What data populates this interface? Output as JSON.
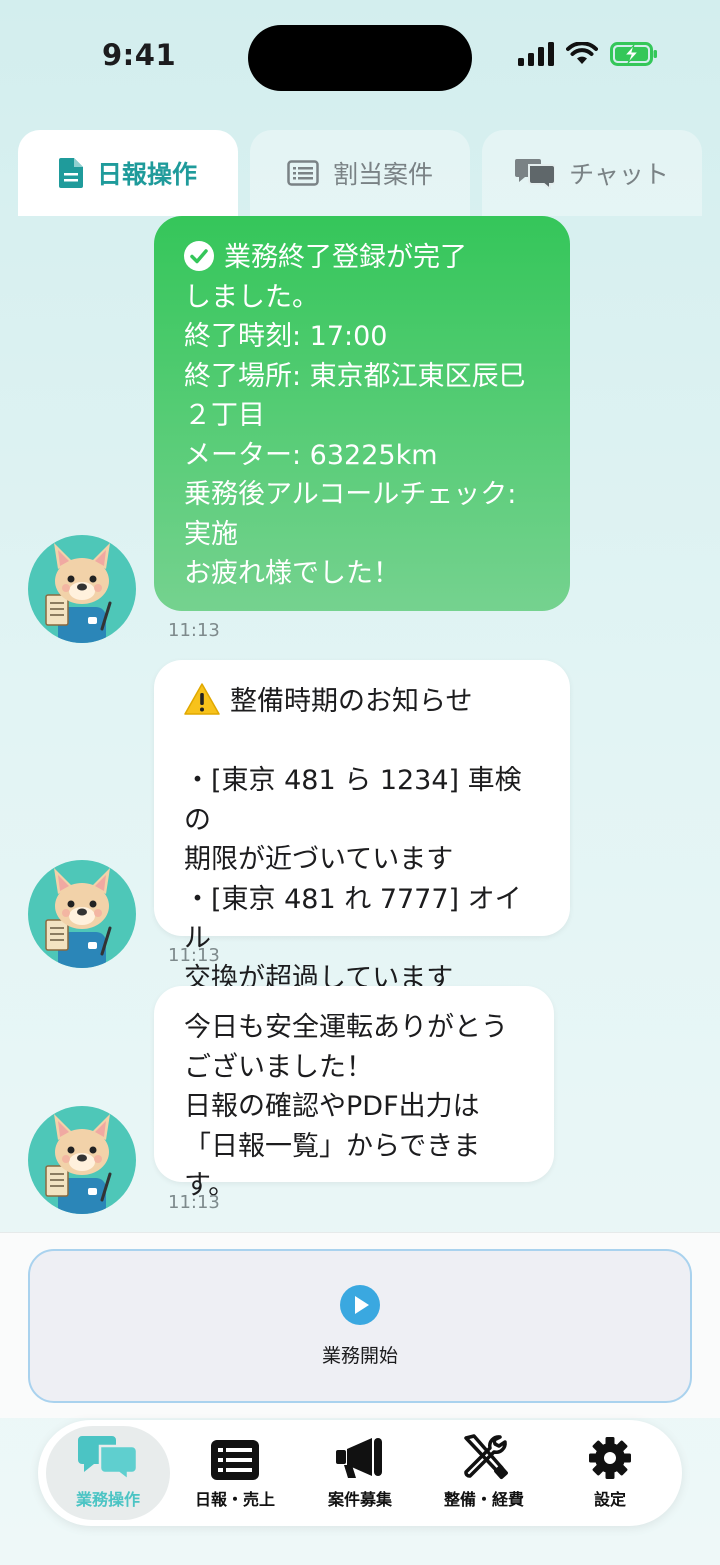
{
  "status_bar": {
    "time": "9:41"
  },
  "tabs": [
    {
      "label": "日報操作",
      "icon": "document-icon",
      "active": true
    },
    {
      "label": "割当案件",
      "icon": "list-icon",
      "active": false
    },
    {
      "label": "チャット",
      "icon": "chat-bubbles-icon",
      "active": false
    }
  ],
  "messages": [
    {
      "type": "green",
      "icon": "check-circle-icon",
      "text": "業務終了登録が完了\nしました。\n終了時刻: 17:00\n終了場所: 東京都江東区辰巳\n２丁目\nメーター: 63225km\n乗務後アルコールチェック:\n実施\nお疲れ様でした！",
      "time": "11:13"
    },
    {
      "type": "white",
      "icon": "warning-icon",
      "text": "整備時期のお知らせ\n\n・[東京 481 ら 1234] 車検の\n期限が近づいています\n・[東京 481 れ 7777] オイル\n交換が超過しています",
      "time": "11:13"
    },
    {
      "type": "white",
      "text": "今日も安全運転ありがとう\nございました！\n日報の確認やPDF出力は\n「日報一覧」からできます。",
      "time": "11:13"
    }
  ],
  "action": {
    "label": "業務開始",
    "icon": "play-icon"
  },
  "nav": [
    {
      "label": "業務操作",
      "icon": "chat-bubbles-icon",
      "active": true
    },
    {
      "label": "日報・売上",
      "icon": "list-icon",
      "active": false
    },
    {
      "label": "案件募集",
      "icon": "megaphone-icon",
      "active": false
    },
    {
      "label": "整備・経費",
      "icon": "tools-icon",
      "active": false
    },
    {
      "label": "設定",
      "icon": "gear-icon",
      "active": false
    }
  ],
  "colors": {
    "accent": "#1f9b9b",
    "green": "#35c65a",
    "nav_active": "#4bc4c4",
    "play": "#3aa8e0"
  }
}
